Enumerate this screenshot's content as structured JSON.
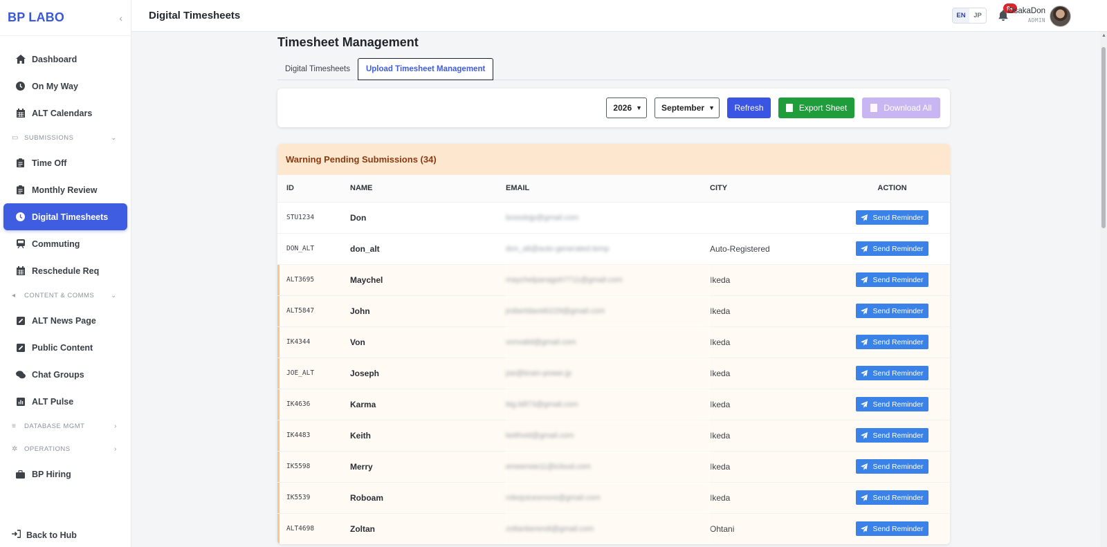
{
  "brand": "BP LABO",
  "header": {
    "title": "Digital Timesheets",
    "lang_en": "EN",
    "lang_jp": "JP",
    "notif_badge": "9+",
    "user_name": "OsakaDon",
    "user_role": "ADMIN"
  },
  "sidebar": {
    "items_top": [
      "Dashboard",
      "On My Way",
      "ALT Calendars"
    ],
    "section_submissions": "SUBMISSIONS",
    "items_sub": [
      "Time Off",
      "Monthly Review",
      "Digital Timesheets",
      "Commuting",
      "Reschedule Req"
    ],
    "section_content": "CONTENT & COMMS",
    "items_content": [
      "ALT News Page",
      "Public Content",
      "Chat Groups",
      "ALT Pulse"
    ],
    "section_db": "DATABASE MGMT",
    "section_ops": "OPERATIONS",
    "item_hiring": "BP Hiring",
    "back_hub": "Back to Hub"
  },
  "main": {
    "title": "Timesheet Management",
    "tabs": [
      "Digital Timesheets",
      "Upload Timesheet Management"
    ],
    "year": "2026",
    "month": "September",
    "refresh": "Refresh",
    "export": "Export Sheet",
    "download": "Download All",
    "panel_title": "Warning Pending Submissions (34)",
    "columns": [
      "ID",
      "NAME",
      "EMAIL",
      "CITY",
      "ACTION"
    ],
    "reminder_label": "Send Reminder",
    "rows": [
      {
        "id": "STU1234",
        "name": "Don",
        "email": "bossdojp@gmail.com",
        "city": ""
      },
      {
        "id": "DON_ALT",
        "name": "don_alt",
        "email": "don_alt@auto-generated.temp",
        "city": "Auto-Registered"
      },
      {
        "id": "ALT3695",
        "name": "Maychel",
        "email": "maychelpanagoh7711@gmail.com",
        "city": "Ikeda"
      },
      {
        "id": "ALT5847",
        "name": "John",
        "email": "jrobertdavid0229@gmail.com",
        "city": "Ikeda"
      },
      {
        "id": "IK4344",
        "name": "Von",
        "email": "vonvalid@gmail.com",
        "city": "Ikeda"
      },
      {
        "id": "JOE_ALT",
        "name": "Joseph",
        "email": "joe@brain-power.jp",
        "city": "Ikeda"
      },
      {
        "id": "IK4636",
        "name": "Karma",
        "email": "big.bill73@gmail.com",
        "city": "Ikeda"
      },
      {
        "id": "IK4483",
        "name": "Keith",
        "email": "keithvid@gmail.com",
        "city": "Ikeda"
      },
      {
        "id": "IK5598",
        "name": "Merry",
        "email": "emeensie11@icloud.com",
        "city": "Ikeda"
      },
      {
        "id": "IK5539",
        "name": "Roboam",
        "email": "robojuicesmore@gmail.com",
        "city": "Ikeda"
      },
      {
        "id": "ALT4698",
        "name": "Zoltan",
        "email": "zoltanberendi@gmail.com",
        "city": "Ohtani"
      }
    ]
  }
}
